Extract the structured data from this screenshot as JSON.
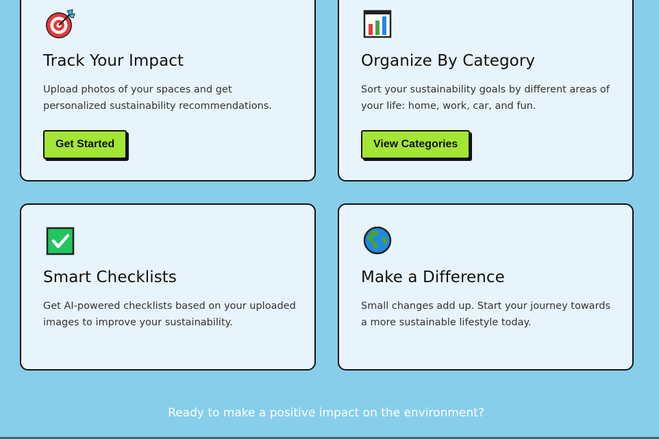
{
  "cards": [
    {
      "icon": "target-icon",
      "title": "Track Your Impact",
      "description": "Upload photos of your spaces and get personalized sustainability recommendations.",
      "button_label": "Get Started"
    },
    {
      "icon": "bar-chart-icon",
      "title": "Organize By Category",
      "description": "Sort your sustainability goals by different areas of your life: home, work, car, and fun.",
      "button_label": "View Categories"
    },
    {
      "icon": "checkmark-icon",
      "title": "Smart Checklists",
      "description": "Get AI-powered checklists based on your uploaded images to improve your sustainability."
    },
    {
      "icon": "globe-icon",
      "title": "Make a Difference",
      "description": "Small changes add up. Start your journey towards a more sustainable lifestyle today."
    }
  ],
  "cta": {
    "text": "Ready to make a positive impact on the environment?"
  },
  "colors": {
    "background": "#87CEEB",
    "card_background": "#E8F4FB",
    "button_accent": "#A3E635",
    "border": "#111111"
  }
}
